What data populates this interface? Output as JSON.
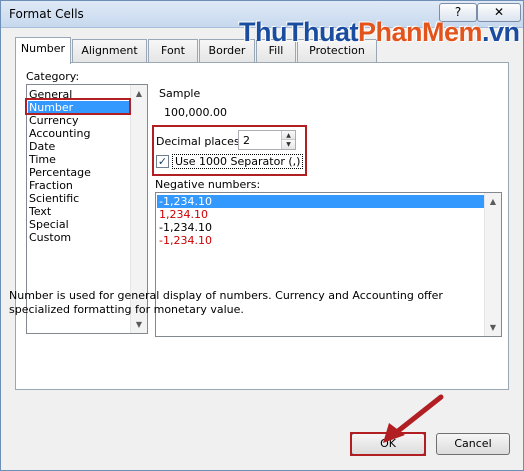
{
  "window": {
    "title": "Format Cells",
    "help_glyph": "?",
    "close_glyph": "✕"
  },
  "watermark": {
    "part1": "ThuThuat",
    "part2": "PhanMem",
    "part3": ".vn"
  },
  "tabs": [
    {
      "label": "Number",
      "active": true
    },
    {
      "label": "Alignment",
      "active": false
    },
    {
      "label": "Font",
      "active": false
    },
    {
      "label": "Border",
      "active": false
    },
    {
      "label": "Fill",
      "active": false
    },
    {
      "label": "Protection",
      "active": false
    }
  ],
  "category": {
    "label": "Category:",
    "items": [
      "General",
      "Number",
      "Currency",
      "Accounting",
      "Date",
      "Time",
      "Percentage",
      "Fraction",
      "Scientific",
      "Text",
      "Special",
      "Custom"
    ],
    "selected": "Number"
  },
  "sample": {
    "label": "Sample",
    "value": "100,000.00"
  },
  "decimal_places": {
    "label": "Decimal places:",
    "value": "2"
  },
  "separator": {
    "label": "Use 1000 Separator (,)",
    "checked": true
  },
  "negative_numbers": {
    "label": "Negative numbers:",
    "items": [
      "-1,234.10",
      "1,234.10",
      "-1,234.10",
      "-1,234.10"
    ],
    "red_indices": [
      1,
      3
    ],
    "selected_index": 0
  },
  "description": "Number is used for general display of numbers.  Currency and Accounting offer specialized formatting for monetary value.",
  "buttons": {
    "ok": "OK",
    "cancel": "Cancel"
  },
  "colors": {
    "highlight": "#b11f23",
    "selection": "#3399ff",
    "negative_red": "#cc0000",
    "arrow": "#b11f23"
  },
  "icons": {
    "spin_up": "triangle-up",
    "spin_down": "triangle-down",
    "scroll_up": "triangle-up",
    "scroll_down": "triangle-down",
    "checkmark": "check"
  }
}
